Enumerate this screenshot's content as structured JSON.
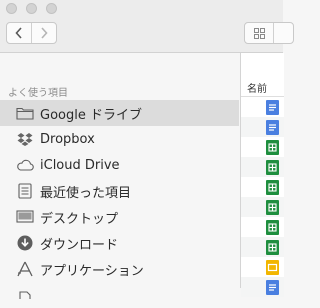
{
  "sidebar": {
    "section_title": "よく使う項目",
    "items": [
      {
        "label": "Google ドライブ",
        "icon": "folder-icon",
        "selected": true
      },
      {
        "label": "Dropbox",
        "icon": "dropbox-icon"
      },
      {
        "label": "iCloud Drive",
        "icon": "cloud-icon"
      },
      {
        "label": "最近使った項目",
        "icon": "recents-icon"
      },
      {
        "label": "デスクトップ",
        "icon": "desktop-icon"
      },
      {
        "label": "ダウンロード",
        "icon": "download-icon"
      },
      {
        "label": "アプリケーション",
        "icon": "applications-icon"
      }
    ]
  },
  "file_list": {
    "column_header": "名前",
    "rows": [
      {
        "icon": "google-docs-icon",
        "color": "#4a7fe0"
      },
      {
        "icon": "google-docs-icon",
        "color": "#4a7fe0"
      },
      {
        "icon": "google-sheets-icon",
        "color": "#1e8e3e"
      },
      {
        "icon": "google-sheets-icon",
        "color": "#1e8e3e"
      },
      {
        "icon": "google-sheets-icon",
        "color": "#1e8e3e"
      },
      {
        "icon": "google-sheets-icon",
        "color": "#1e8e3e"
      },
      {
        "icon": "google-sheets-icon",
        "color": "#1e8e3e"
      },
      {
        "icon": "google-sheets-icon",
        "color": "#1e8e3e"
      },
      {
        "icon": "google-slides-icon",
        "color": "#f2b600"
      },
      {
        "icon": "google-docs-icon",
        "color": "#4a7fe0"
      }
    ]
  },
  "colors": {
    "selection": "#dcdcdc",
    "docs": "#4a7fe0",
    "sheets": "#1e8e3e",
    "slides": "#f2b600"
  }
}
